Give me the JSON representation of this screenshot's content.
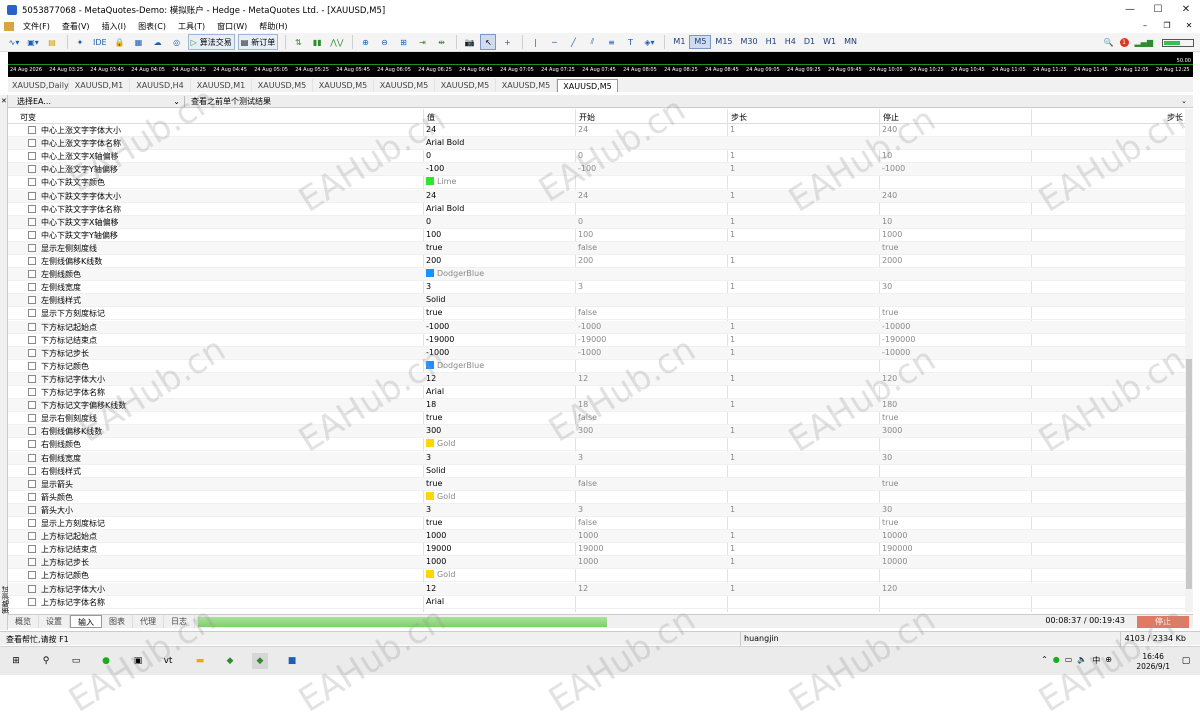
{
  "window": {
    "title": "5053877068 - MetaQuotes-Demo: 模拟账户 - Hedge - MetaQuotes Ltd. - [XAUUSD,M5]",
    "minimize": "—",
    "maximize": "☐",
    "close": "✕"
  },
  "menu": {
    "items": [
      "文件(F)",
      "查看(V)",
      "插入(I)",
      "图表(C)",
      "工具(T)",
      "窗口(W)",
      "帮助(H)"
    ],
    "mdi": [
      "–",
      "❐",
      "✕"
    ]
  },
  "toolbar": {
    "ide": "IDE",
    "algo_trading": "算法交易",
    "new_order": "新订单",
    "timeframes": [
      "M1",
      "M5",
      "M15",
      "M30",
      "H1",
      "H4",
      "D1",
      "W1",
      "MN"
    ],
    "active_timeframe": "M5",
    "notification_count": "1",
    "battery_level": 0.6
  },
  "chart": {
    "price_label": "50.00",
    "times": [
      "24 Aug 2026",
      "24 Aug 03:25",
      "24 Aug 03:45",
      "24 Aug 04:05",
      "24 Aug 04:25",
      "24 Aug 04:45",
      "24 Aug 05:05",
      "24 Aug 05:25",
      "24 Aug 05:45",
      "24 Aug 06:05",
      "24 Aug 06:25",
      "24 Aug 06:45",
      "24 Aug 07:05",
      "24 Aug 07:25",
      "24 Aug 07:45",
      "24 Aug 08:05",
      "24 Aug 08:25",
      "24 Aug 08:45",
      "24 Aug 09:05",
      "24 Aug 09:25",
      "24 Aug 09:45",
      "24 Aug 10:05",
      "24 Aug 10:25",
      "24 Aug 10:45",
      "24 Aug 11:05",
      "24 Aug 11:25",
      "24 Aug 11:45",
      "24 Aug 12:05",
      "24 Aug 12:25"
    ]
  },
  "chart_tabs": [
    "XAUUSD,Daily",
    "XAUUSD,M1",
    "XAUUSD,H4",
    "XAUUSD,M1",
    "XAUUSD,M5",
    "XAUUSD,M5",
    "XAUUSD,M5",
    "XAUUSD,M5",
    "XAUUSD,M5",
    "XAUUSD,M5"
  ],
  "active_chart_tab": 9,
  "panel": {
    "ea_select": "选择EA...",
    "subtitle": "查看之前单个测试结果",
    "side_label": "策略测试",
    "side_close": "✕"
  },
  "grid": {
    "headers": {
      "name": "可变",
      "value": "值",
      "start": "开始",
      "step": "步长",
      "stop": "停止",
      "step2": "步长"
    },
    "rows": [
      {
        "name": "中心上涨文字字体大小",
        "value": "24",
        "start": "24",
        "step": "1",
        "stop": "240"
      },
      {
        "name": "中心上涨文字字体名称",
        "value": "Arial Bold",
        "start": "",
        "step": "",
        "stop": ""
      },
      {
        "name": "中心上涨文字X轴偏移",
        "value": "0",
        "start": "0",
        "step": "1",
        "stop": "10"
      },
      {
        "name": "中心上涨文字Y轴偏移",
        "value": "-100",
        "start": "-100",
        "step": "1",
        "stop": "-1000"
      },
      {
        "name": "中心下跌文字颜色",
        "value": "Lime",
        "color": "#2ee62e",
        "start": "",
        "step": "",
        "stop": ""
      },
      {
        "name": "中心下跌文字字体大小",
        "value": "24",
        "start": "24",
        "step": "1",
        "stop": "240"
      },
      {
        "name": "中心下跌文字字体名称",
        "value": "Arial Bold",
        "start": "",
        "step": "",
        "stop": ""
      },
      {
        "name": "中心下跌文字X轴偏移",
        "value": "0",
        "start": "0",
        "step": "1",
        "stop": "10"
      },
      {
        "name": "中心下跌文字Y轴偏移",
        "value": "100",
        "start": "100",
        "step": "1",
        "stop": "1000"
      },
      {
        "name": "显示左侧刻度线",
        "value": "true",
        "start": "false",
        "step": "",
        "stop": "true"
      },
      {
        "name": "左侧线偏移K线数",
        "value": "200",
        "start": "200",
        "step": "1",
        "stop": "2000"
      },
      {
        "name": "左侧线颜色",
        "value": "DodgerBlue",
        "color": "#1e90ff",
        "start": "",
        "step": "",
        "stop": ""
      },
      {
        "name": "左侧线宽度",
        "value": "3",
        "start": "3",
        "step": "1",
        "stop": "30"
      },
      {
        "name": "左侧线样式",
        "value": "Solid",
        "start": "",
        "step": "",
        "stop": ""
      },
      {
        "name": "显示下方刻度标记",
        "value": "true",
        "start": "false",
        "step": "",
        "stop": "true"
      },
      {
        "name": "下方标记起始点",
        "value": "-1000",
        "start": "-1000",
        "step": "1",
        "stop": "-10000"
      },
      {
        "name": "下方标记结束点",
        "value": "-19000",
        "start": "-19000",
        "step": "1",
        "stop": "-190000"
      },
      {
        "name": "下方标记步长",
        "value": "-1000",
        "start": "-1000",
        "step": "1",
        "stop": "-10000"
      },
      {
        "name": "下方标记颜色",
        "value": "DodgerBlue",
        "color": "#1e90ff",
        "start": "",
        "step": "",
        "stop": ""
      },
      {
        "name": "下方标记字体大小",
        "value": "12",
        "start": "12",
        "step": "1",
        "stop": "120"
      },
      {
        "name": "下方标记字体名称",
        "value": "Arial",
        "start": "",
        "step": "",
        "stop": ""
      },
      {
        "name": "下方标记文字偏移K线数",
        "value": "18",
        "start": "18",
        "step": "1",
        "stop": "180"
      },
      {
        "name": "显示右侧刻度线",
        "value": "true",
        "start": "false",
        "step": "",
        "stop": "true"
      },
      {
        "name": "右侧线偏移K线数",
        "value": "300",
        "start": "300",
        "step": "1",
        "stop": "3000"
      },
      {
        "name": "右侧线颜色",
        "value": "Gold",
        "color": "#ffd700",
        "start": "",
        "step": "",
        "stop": ""
      },
      {
        "name": "右侧线宽度",
        "value": "3",
        "start": "3",
        "step": "1",
        "stop": "30"
      },
      {
        "name": "右侧线样式",
        "value": "Solid",
        "start": "",
        "step": "",
        "stop": ""
      },
      {
        "name": "显示箭头",
        "value": "true",
        "start": "false",
        "step": "",
        "stop": "true"
      },
      {
        "name": "箭头颜色",
        "value": "Gold",
        "color": "#ffd700",
        "start": "",
        "step": "",
        "stop": ""
      },
      {
        "name": "箭头大小",
        "value": "3",
        "start": "3",
        "step": "1",
        "stop": "30"
      },
      {
        "name": "显示上方刻度标记",
        "value": "true",
        "start": "false",
        "step": "",
        "stop": "true"
      },
      {
        "name": "上方标记起始点",
        "value": "1000",
        "start": "1000",
        "step": "1",
        "stop": "10000"
      },
      {
        "name": "上方标记结束点",
        "value": "19000",
        "start": "19000",
        "step": "1",
        "stop": "190000"
      },
      {
        "name": "上方标记步长",
        "value": "1000",
        "start": "1000",
        "step": "1",
        "stop": "10000"
      },
      {
        "name": "上方标记颜色",
        "value": "Gold",
        "color": "#ffd700",
        "start": "",
        "step": "",
        "stop": ""
      },
      {
        "name": "上方标记字体大小",
        "value": "12",
        "start": "12",
        "step": "1",
        "stop": "120"
      },
      {
        "name": "上方标记字体名称",
        "value": "Arial",
        "start": "",
        "step": "",
        "stop": ""
      }
    ]
  },
  "bottom": {
    "tabs": [
      "概览",
      "设置",
      "输入",
      "图表",
      "代理",
      "日志"
    ],
    "active_tab": 2,
    "progress": 0.47,
    "timer": "00:08:37 / 00:19:43",
    "stop": "停止"
  },
  "status": {
    "help": "查看帮忙,请按 F1",
    "user": "huangjin",
    "net": "4103 / 2334 Kb"
  },
  "taskbar": {
    "time": "16:46",
    "date": "2026/9/1",
    "ime": "中"
  },
  "watermark": "EAHub.cn"
}
